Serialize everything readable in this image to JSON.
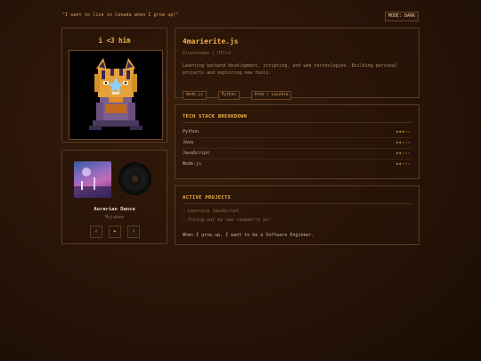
{
  "header": {
    "quote": "\"I want to live in Canada when I grow up!\"",
    "mode_label": "MODE: DARK"
  },
  "profile": {
    "display_name": "i <3 him"
  },
  "player": {
    "track_title": "Aurarian Dance",
    "artist": "Mujabee",
    "prev_label": "‹",
    "play_label": "▸",
    "next_label": "›"
  },
  "info": {
    "handle": "4marierite.js",
    "meta": "bluenoteen | UTC+2",
    "bio": "Learning backend development, scripting, and web technologies. Building personal projects and exploring new tools.",
    "tags": [
      "Node.js",
      "Python",
      "Atom / LazyVim"
    ]
  },
  "stack": {
    "title": "TECH STACK BREAKDOWN",
    "skills": [
      {
        "name": "Python",
        "stars": 3,
        "max": 5
      },
      {
        "name": "Java",
        "stars": 2,
        "max": 5
      },
      {
        "name": "JavaScript",
        "stars": 2,
        "max": 5
      },
      {
        "name": "Node.js",
        "stars": 2,
        "max": 5
      }
    ]
  },
  "projects": {
    "title": "ACTIVE PROJECTS",
    "items": [
      "~ Learning JavaScript",
      "~ Trying out my new raspberry pi!"
    ],
    "dream": "When I grow up, I want to be a Software Engineer."
  },
  "colors": {
    "accent": "#f2b24a",
    "background": "#2a1508",
    "border": "#5a3a22"
  }
}
